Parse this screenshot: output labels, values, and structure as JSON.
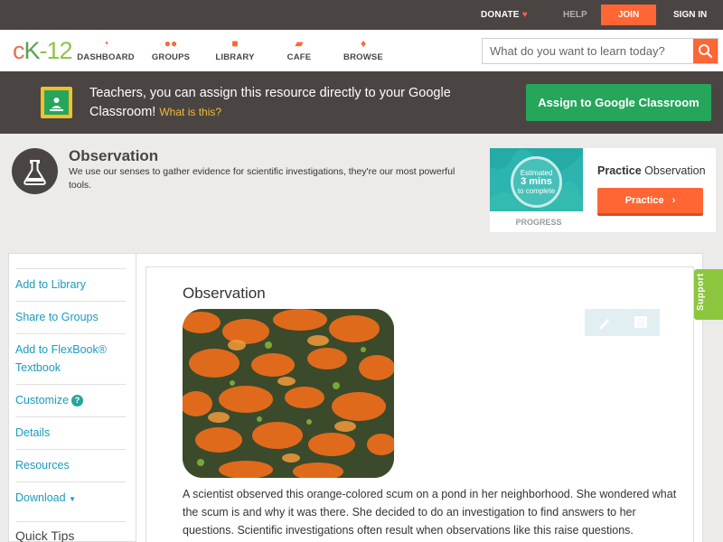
{
  "topbar": {
    "donate": "DONATE",
    "help": "HELP",
    "join": "JOIN",
    "signin": "SIGN IN"
  },
  "nav": {
    "items": [
      {
        "label": "DASHBOARD",
        "icon": "dashboard-icon"
      },
      {
        "label": "GROUPS",
        "icon": "groups-icon"
      },
      {
        "label": "LIBRARY",
        "icon": "library-icon"
      },
      {
        "label": "CAFE",
        "icon": "cafe-icon"
      },
      {
        "label": "BROWSE",
        "icon": "browse-icon"
      }
    ],
    "search_placeholder": "What do you want to learn today?"
  },
  "banner": {
    "text": "Teachers, you can assign this resource directly to your Google Classroom!",
    "link": "What is this?",
    "button": "Assign to Google Classroom"
  },
  "concept": {
    "title": "Observation",
    "description": "We use our senses to gather evidence for scientific investigations, they're our most powerful tools."
  },
  "practice": {
    "estimated": "Estimated",
    "mins": "3 mins",
    "complete": "to complete",
    "progress_label": "PROGRESS",
    "title_bold": "Practice",
    "title_rest": "Observation",
    "button": "Practice"
  },
  "sidebar": {
    "items": [
      "Add to Library",
      "Share to Groups",
      "Add to FlexBook® Textbook",
      "Customize",
      "Details",
      "Resources",
      "Download"
    ],
    "quick_tips": "Quick Tips"
  },
  "document": {
    "title": "Observation",
    "paragraph": "A scientist observed this orange-colored scum on a pond in her neighborhood. She wondered what the scum is and why it was there. She decided to do an investigation to find answers to her questions. Scientific investigations often result when observations like this raise questions."
  },
  "support": "Support",
  "colors": {
    "accent": "#ff6633",
    "dark": "#4a4543",
    "google_green": "#26a65b",
    "link": "#1a9bbf"
  }
}
